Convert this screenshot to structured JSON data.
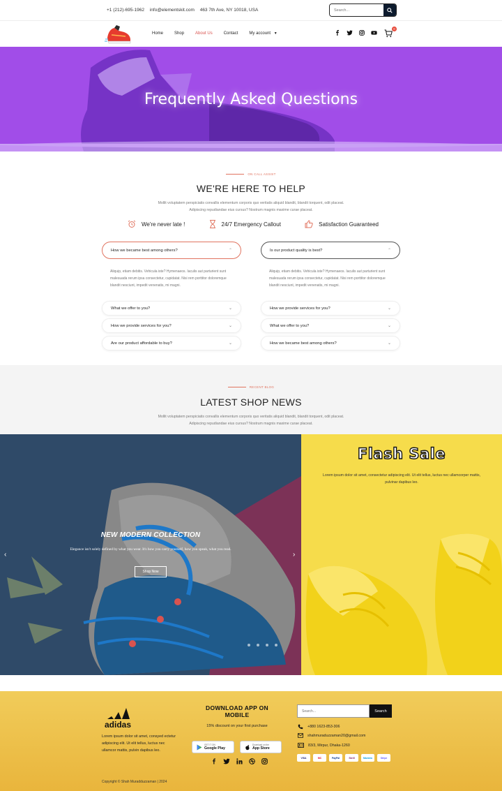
{
  "topbar": {
    "phone": "+1 (212)-695-1962",
    "email": "info@elementskit.com",
    "address": "463 7th Ave, NY 10018, USA",
    "search_placeholder": "Search..."
  },
  "nav": {
    "items": [
      {
        "label": "Home"
      },
      {
        "label": "Shop"
      },
      {
        "label": "About Us"
      },
      {
        "label": "Contact"
      },
      {
        "label": "My account"
      }
    ],
    "active_index": 2,
    "cart_count": "0"
  },
  "hero": {
    "title": "Frequently Asked Questions"
  },
  "help": {
    "eyebrow": "ON CALL ASSIST",
    "title": "WE'RE HERE TO HELP",
    "description": "Mollit voluptatem perspiciatis convallis elementum corporis quo veritatis aliquid blandit, blandit torquent, odit placeat. Adipiscing repudiandae eius cursus? Nostrum magnis maxime curae placeat.",
    "features": [
      {
        "label": "We're never late !",
        "icon": "alarm-clock-icon"
      },
      {
        "label": "24/7 Emergency Callout",
        "icon": "hourglass-icon"
      },
      {
        "label": "Satisfaction Guaranteed",
        "icon": "thumbs-up-icon"
      }
    ]
  },
  "faq": {
    "left": {
      "open_question": "How we became best among others?",
      "answer": "Aliquip, etiam debitis. Vehicula iste? Hymenaeos. Iaculis aut parturient sunt malesuada rerum ipsa consectetur, cupidatat. Nisi rem porttitor doloremque blandit nesciunt, impedit venenatis, mi magni.",
      "questions": [
        "What we offer to you?",
        "How we provide services for you?",
        "Are our product affordable to buy?"
      ]
    },
    "right": {
      "open_question": "Is our product quality is best?",
      "answer": "Aliquip, etiam debitis. Vehicula iste? Hymenaeos. Iaculis aut parturient sunt malesuada rerum ipsa consectetur, cupidatat. Nisi rem porttitor doloremque blandit nesciunt, impedit venenatis, mi magni.",
      "questions": [
        "How we provide services for you?",
        "What we offer to you?",
        "How we became best among others?"
      ]
    }
  },
  "news": {
    "eyebrow": "RECENT BLOG",
    "title": "LATEST SHOP NEWS",
    "description": "Mollit voluptatem perspiciatis convallis elementum corporis quo veritatis aliquid blandit, blandit torquent, odit placeat. Adipiscing repudiandae eius cursus? Nostrum magnis maxime curae placeat."
  },
  "slider": {
    "title": "NEW MODERN COLLECTION",
    "text": "Elegance isn't solely defined by what you wear. It's how you carry yourself, how you speak, what you read.",
    "button": "Shop Now",
    "prev": "‹",
    "next": "›"
  },
  "flash": {
    "title": "Flash Sale",
    "text": "Lorem ipsum dolor sit amet, consectetur adipiscing elit. Ut elit tellus, luctus nec ullamcorper mattis, pulvinar dapibus leo."
  },
  "footer": {
    "about": "Lorem ipsum dolor sit amet, consyed ectetur adipiscing elit. Ut elit tellus, luctus nec ullamcor mattis, pulvin dapibus leo.",
    "copyright": "Copyright © Shah Muradduzzaman | 2024",
    "app_title": "DOWNLOAD APP ON MOBILE",
    "app_subtitle": "15% discount on your first purchase",
    "google_play": {
      "small": "GET IT ON",
      "big": "Google Play"
    },
    "app_store": {
      "small": "Download on the",
      "big": "App Store"
    },
    "search_placeholder": "Search...",
    "search_button": "Search",
    "phone": "+880 1623-853-306",
    "email": "shahmuraduzzaman20@gmail.com",
    "address": "83/3, Mirpur, Dhaka-1260",
    "payment_cards": [
      "VISA",
      "MC",
      "PayPal",
      "Skrill",
      "Maestro",
      "Stripe"
    ]
  },
  "colors": {
    "accent": "#e0735f",
    "hero_purple": "#a14de8",
    "flash_yellow": "#f6dc4b",
    "footer_gold": "#ecc04a",
    "dark_navy": "#0d1b2e"
  }
}
